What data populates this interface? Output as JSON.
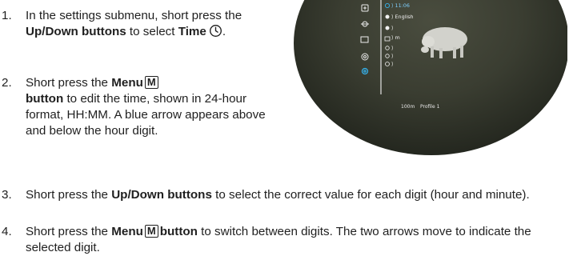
{
  "steps": [
    {
      "number": "1.",
      "pre": "In the settings submenu, short press the ",
      "bold1": "Up/Down buttons",
      "mid": " to select ",
      "bold2": "Time",
      "post": "."
    },
    {
      "number": "2.",
      "pre": "Short press the ",
      "bold1": "Menu",
      "key": "M",
      "bold2": "button",
      "post": " to edit the time, shown in 24-hour format, HH:MM. A blue arrow appears above and below the hour digit."
    },
    {
      "number": "3.",
      "pre": "Short press the ",
      "bold1": "Up/Down buttons",
      "post": " to select the correct value for each digit (hour and minute)."
    },
    {
      "number": "4.",
      "pre": "Short press the ",
      "bold1": "Menu",
      "key": "M",
      "bold2": "button",
      "post": " to switch between digits. The two arrows move to indicate the selected digit."
    }
  ],
  "device_screen": {
    "menu": [
      {
        "text": "⟩ 11:06"
      },
      {
        "text": "⟩ English"
      },
      {
        "text": "⟩"
      },
      {
        "text": "⟩ m"
      },
      {
        "text": "⟩"
      },
      {
        "text": "⟩"
      },
      {
        "text": "⟩"
      }
    ],
    "status": {
      "distance": "100m",
      "profile": "Profile 1"
    },
    "accent_color": "#35b4f0"
  }
}
